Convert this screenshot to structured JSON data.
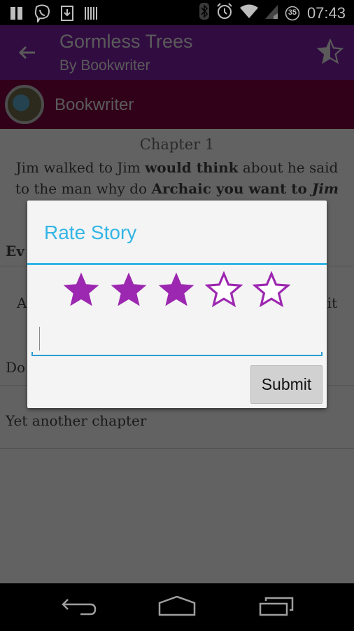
{
  "status_bar": {
    "time": "07:43",
    "battery_level": "35",
    "left_icons": [
      "pause-icon",
      "viber-icon",
      "download-icon",
      "barcode-icon"
    ],
    "right_icons": [
      "bluetooth-icon",
      "alarm-icon",
      "wifi-icon",
      "signal-icon",
      "battery-icon"
    ]
  },
  "app_bar": {
    "title": "Gormless Trees",
    "subtitle": "By Bookwriter",
    "action_icon": "rate-star-icon"
  },
  "author_bar": {
    "name": "Bookwriter"
  },
  "content": {
    "chapter_heading": "Chapter 1",
    "chapter_text_parts": [
      {
        "text": "Jim walked to Jim ",
        "style": "normal"
      },
      {
        "text": "would think",
        "style": "bold"
      },
      {
        "text": " about he said to the man why do ",
        "style": "normal"
      },
      {
        "text": "Archaic you want to ",
        "style": "bold"
      },
      {
        "text": "Jim",
        "style": "bold-italic"
      }
    ],
    "list_rows": [
      {
        "left": "Ev",
        "right": ""
      },
      {
        "left": "A",
        "right": "it"
      },
      {
        "left": "Do",
        "right": ""
      },
      {
        "left": "Yet another chapter",
        "right": ""
      }
    ]
  },
  "dialog": {
    "title": "Rate Story",
    "rating": 3,
    "max_rating": 5,
    "comment_value": "",
    "submit_label": "Submit",
    "accent_color": "#33b5e5",
    "star_color": "#9c27b0"
  },
  "nav_bar": {
    "buttons": [
      "back-icon",
      "home-icon",
      "recents-icon"
    ]
  }
}
